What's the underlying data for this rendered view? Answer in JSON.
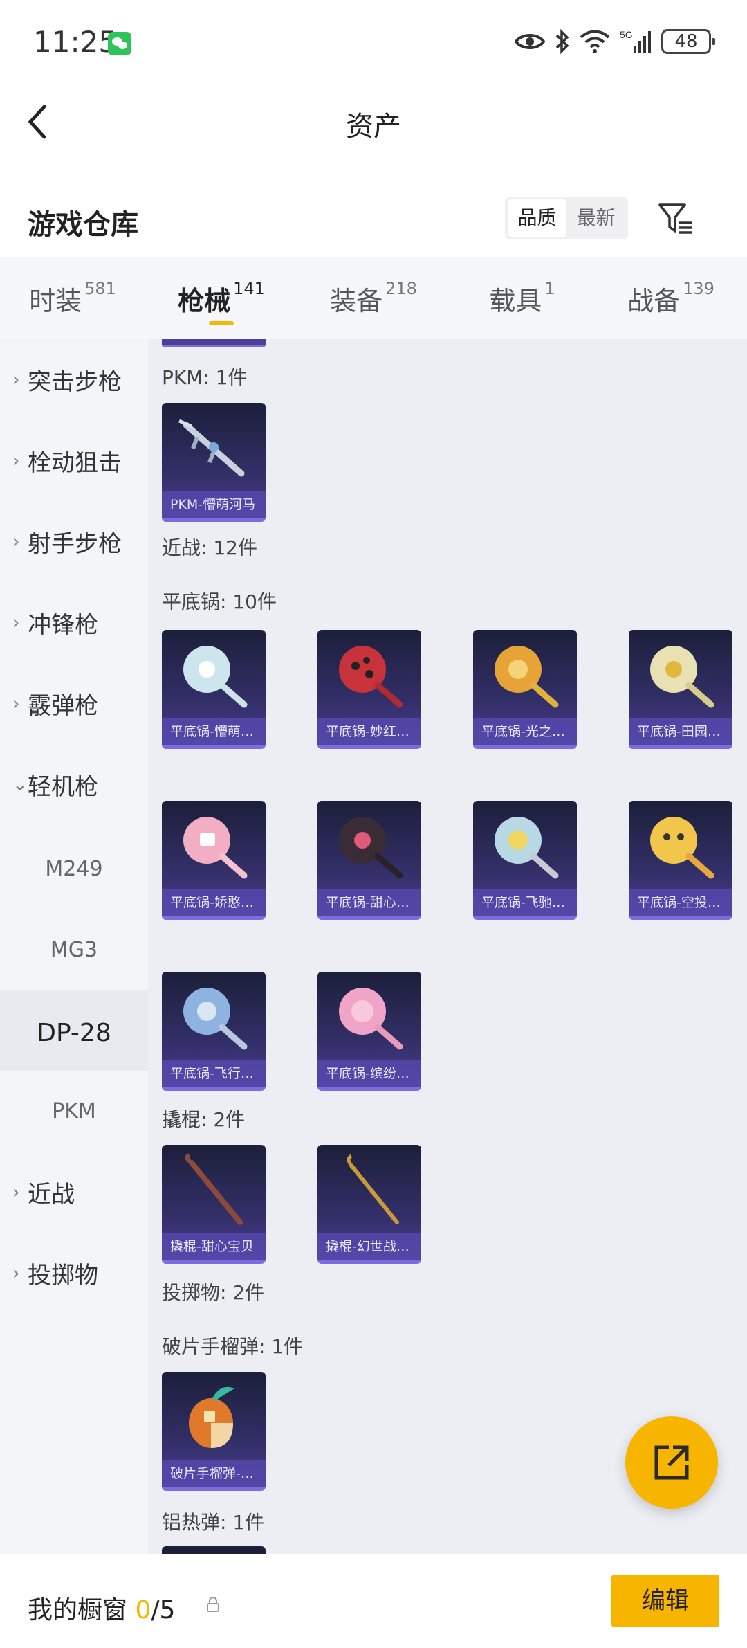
{
  "status_bar": {
    "time": "11:25",
    "battery": "48",
    "network": "5G"
  },
  "header": {
    "title": "资产"
  },
  "section": {
    "title": "游戏仓库",
    "sort_options": [
      "品质",
      "最新"
    ],
    "sort_selected": "品质"
  },
  "tabs": [
    {
      "label": "时装",
      "count": "581"
    },
    {
      "label": "枪械",
      "count": "141",
      "active": true
    },
    {
      "label": "装备",
      "count": "218"
    },
    {
      "label": "载具",
      "count": "1"
    },
    {
      "label": "战备",
      "count": "139"
    }
  ],
  "sidebar": {
    "categories": [
      "突击步枪",
      "栓动狙击",
      "射手步枪",
      "冲锋枪",
      "霰弹枪",
      "轻机枪",
      "近战",
      "投掷物"
    ],
    "expanded": "轻机枪",
    "subitems": [
      "M249",
      "MG3",
      "DP-28",
      "PKM"
    ],
    "selected_subitem": "DP-28"
  },
  "content": {
    "groups": [
      {
        "label": "PKM: 1件",
        "items": [
          "PKM-懵萌河马"
        ]
      },
      {
        "label": "近战: 12件",
        "items": []
      },
      {
        "label": "平底锅: 10件",
        "items": [
          "平底锅-懵萌…",
          "平底锅-妙红…",
          "平底锅-光之…",
          "平底锅-田园…",
          "平底锅-娇憨…",
          "平底锅-甜心…",
          "平底锅-飞驰…",
          "平底锅-空投…",
          "平底锅-飞行…",
          "平底锅-缤纷…"
        ]
      },
      {
        "label": "撬棍: 2件",
        "items": [
          "撬棍-甜心宝贝",
          "撬棍-幻世战…"
        ]
      },
      {
        "label": "投掷物: 2件",
        "items": []
      },
      {
        "label": "破片手榴弹: 1件",
        "items": [
          "破片手榴弹-…"
        ]
      },
      {
        "label": "铝热弹: 1件",
        "items": []
      }
    ]
  },
  "bottom_bar": {
    "showcase_label": "我的橱窗",
    "showcase_count": "0",
    "showcase_total": "/5",
    "edit_label": "编辑"
  },
  "colors": {
    "accent": "#f7b500",
    "card_dark": "#1c1f3a",
    "card_purple": "#4c3f95"
  },
  "icons": [
    "wechat-icon",
    "eye-icon",
    "bluetooth-icon",
    "wifi-icon",
    "signal-icon",
    "battery-icon",
    "back-arrow-icon",
    "filter-icon",
    "chevron-right-icon",
    "chevron-down-icon",
    "lock-icon",
    "share-icon"
  ]
}
